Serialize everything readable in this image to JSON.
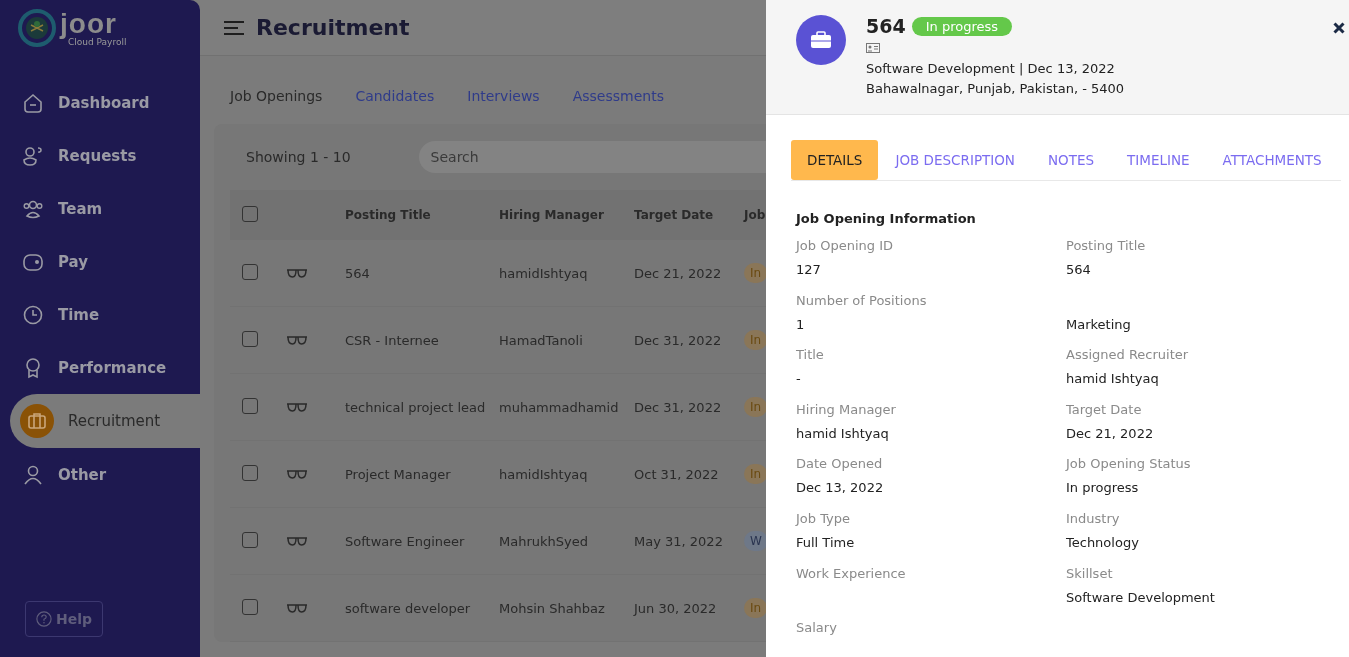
{
  "sidebar": {
    "logo": "joor",
    "logo_sub": "Cloud Payroll",
    "items": [
      {
        "label": "Dashboard",
        "selected": false
      },
      {
        "label": "Requests",
        "selected": false
      },
      {
        "label": "Team",
        "selected": false
      },
      {
        "label": "Pay",
        "selected": false
      },
      {
        "label": "Time",
        "selected": false
      },
      {
        "label": "Performance",
        "selected": false
      },
      {
        "label": "Recruitment",
        "selected": true
      },
      {
        "label": "Other",
        "selected": false
      }
    ],
    "help": "Help"
  },
  "header": {
    "title": "Recruitment"
  },
  "tabs": [
    {
      "label": "Job Openings",
      "selected": true
    },
    {
      "label": "Candidates",
      "selected": false
    },
    {
      "label": "Interviews",
      "selected": false
    },
    {
      "label": "Assessments",
      "selected": false
    }
  ],
  "table": {
    "showing": "Showing 1 - 10",
    "search_placeholder": "Search",
    "all_checked": false,
    "columns": [
      "Posting Title",
      "Hiring Manager",
      "Target Date",
      "Job"
    ],
    "rows": [
      {
        "checked": false,
        "title": "564",
        "manager": "hamidIshtyaq",
        "date": "Dec 21, 2022",
        "status": "In",
        "kind": "progress"
      },
      {
        "checked": false,
        "title": "CSR - Internee",
        "manager": "HamadTanoli",
        "date": "Dec 31, 2022",
        "status": "In",
        "kind": "progress"
      },
      {
        "checked": false,
        "title": "technical project lead",
        "manager": "muhammadhamid",
        "date": "Dec 31, 2022",
        "status": "In",
        "kind": "progress"
      },
      {
        "checked": false,
        "title": "Project Manager",
        "manager": "hamidIshtyaq",
        "date": "Oct 31, 2022",
        "status": "In",
        "kind": "progress"
      },
      {
        "checked": false,
        "title": "Software Engineer",
        "manager": "MahrukhSyed",
        "date": "May 31, 2022",
        "status": "W",
        "kind": "waiting"
      },
      {
        "checked": false,
        "title": "software developer",
        "manager": "Mohsin Shahbaz",
        "date": "Jun 30, 2022",
        "status": "In",
        "kind": "progress"
      }
    ]
  },
  "drawer": {
    "title": "564",
    "status": "In progress",
    "subtitle": "Software Development | Dec 13, 2022",
    "address": "Bahawalnagar, Punjab, Pakistan, - 5400",
    "tabs": [
      {
        "label": "DETAILS",
        "selected": true
      },
      {
        "label": "JOB DESCRIPTION",
        "selected": false
      },
      {
        "label": "NOTES",
        "selected": false
      },
      {
        "label": "TIMELINE",
        "selected": false
      },
      {
        "label": "ATTACHMENTS",
        "selected": false
      }
    ],
    "section_title": "Job Opening Information",
    "left": [
      {
        "label": "Job Opening ID",
        "value": "127"
      },
      {
        "label": "Number of Positions",
        "value": "1"
      },
      {
        "label": "Title",
        "value": "-"
      },
      {
        "label": "Hiring Manager",
        "value": "hamid Ishtyaq"
      },
      {
        "label": "Date Opened",
        "value": "Dec 13, 2022"
      },
      {
        "label": "Job Type",
        "value": "Full Time"
      },
      {
        "label": "Work Experience"
      },
      {
        "label": "Salary"
      }
    ],
    "right": [
      {
        "label": "Posting Title",
        "value": "564"
      },
      {
        "value": "Marketing"
      },
      {
        "label": "Assigned Recruiter",
        "value": "hamid Ishtyaq"
      },
      {
        "label": "Target Date",
        "value": "Dec 21, 2022"
      },
      {
        "label": "Job Opening Status",
        "value": "In progress"
      },
      {
        "label": "Industry",
        "value": "Technology"
      },
      {
        "label": "Skillset",
        "value": "Software Development"
      }
    ]
  }
}
